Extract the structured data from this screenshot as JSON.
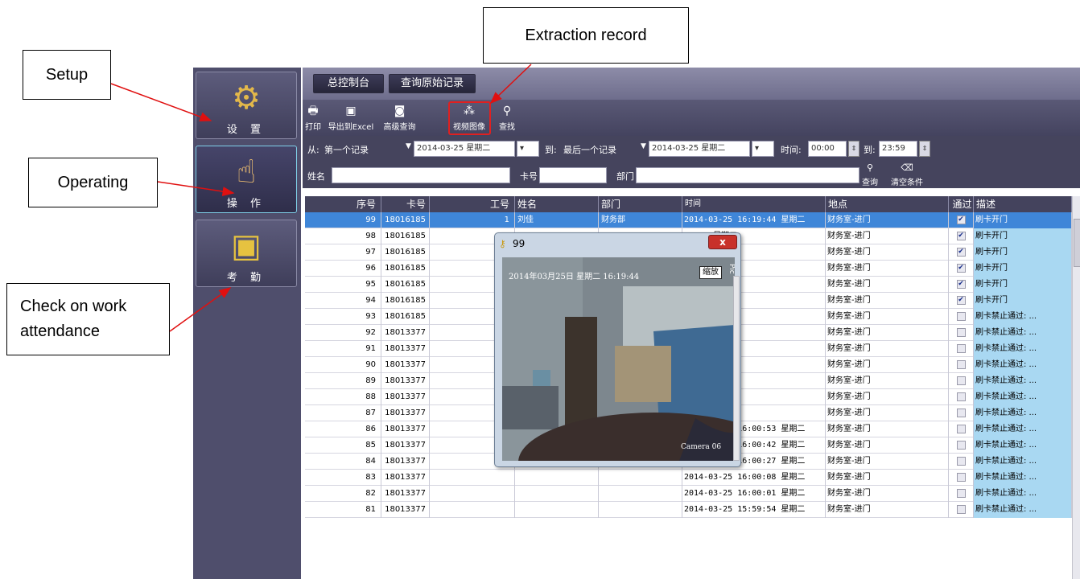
{
  "callouts": {
    "setup": "Setup",
    "extraction": "Extraction record",
    "operating": "Operating",
    "check_line1": "Check on work",
    "check_line2": "attendance"
  },
  "sidebar": {
    "items": [
      {
        "label": "设 置",
        "icon": "gear-icon"
      },
      {
        "label": "操 作",
        "icon": "hand-pointer-icon"
      },
      {
        "label": "考 勤",
        "icon": "id-card-icon"
      }
    ]
  },
  "tabs": [
    "总控制台",
    "查询原始记录"
  ],
  "toolbar": {
    "print": "打印",
    "excel": "导出到Excel",
    "advanced": "高级查询",
    "video": "视频图像",
    "find": "查找"
  },
  "filter": {
    "from_label": "从:",
    "from_value": "第一个记录",
    "from_date": "2014-03-25 星期二",
    "to_label": "到:",
    "to_value": "最后一个记录",
    "to_date": "2014-03-25 星期二",
    "time_label": "时间:",
    "time_from": "00:00",
    "time_to_label": "到:",
    "time_to": "23:59",
    "name_label": "姓名",
    "card_label": "卡号",
    "dept_label": "部门",
    "query_btn": "查询",
    "clear_btn": "清空条件"
  },
  "grid": {
    "headers": [
      "序号",
      "卡号",
      "工号",
      "姓名",
      "部门",
      "时间",
      "地点",
      "通过",
      "描述"
    ],
    "rows": [
      {
        "no": "99",
        "card": "18016185",
        "emp": "1",
        "name": "刘佳",
        "dept": "财务部",
        "time": "2014-03-25 16:19:44 星期二",
        "place": "财务室-进门",
        "pass": true,
        "desc": "刷卡开门"
      },
      {
        "no": "98",
        "card": "18016185",
        "emp": "",
        "name": "",
        "dept": "",
        "time": "19:31 星期二",
        "place": "财务室-进门",
        "pass": true,
        "desc": "刷卡开门"
      },
      {
        "no": "97",
        "card": "18016185",
        "emp": "",
        "name": "",
        "dept": "",
        "time": "18:04 星期二",
        "place": "财务室-进门",
        "pass": true,
        "desc": "刷卡开门"
      },
      {
        "no": "96",
        "card": "18016185",
        "emp": "",
        "name": "",
        "dept": "",
        "time": "17:39 星期二",
        "place": "财务室-进门",
        "pass": true,
        "desc": "刷卡开门"
      },
      {
        "no": "95",
        "card": "18016185",
        "emp": "",
        "name": "",
        "dept": "",
        "time": "17:05 星期二",
        "place": "财务室-进门",
        "pass": true,
        "desc": "刷卡开门"
      },
      {
        "no": "94",
        "card": "18016185",
        "emp": "",
        "name": "",
        "dept": "",
        "time": "08:44 星期二",
        "place": "财务室-进门",
        "pass": true,
        "desc": "刷卡开门"
      },
      {
        "no": "93",
        "card": "18016185",
        "emp": "",
        "name": "",
        "dept": "",
        "time": "06:28 星期二",
        "place": "财务室-进门",
        "pass": false,
        "desc": "刷卡禁止通过: ..."
      },
      {
        "no": "92",
        "card": "18013377",
        "emp": "",
        "name": "",
        "dept": "",
        "time": "02:28 星期二",
        "place": "财务室-进门",
        "pass": false,
        "desc": "刷卡禁止通过: ..."
      },
      {
        "no": "91",
        "card": "18013377",
        "emp": "",
        "name": "",
        "dept": "",
        "time": "02:19 星期二",
        "place": "财务室-进门",
        "pass": false,
        "desc": "刷卡禁止通过: ..."
      },
      {
        "no": "90",
        "card": "18013377",
        "emp": "",
        "name": "",
        "dept": "",
        "time": "02:10 星期二",
        "place": "财务室-进门",
        "pass": false,
        "desc": "刷卡禁止通过: ..."
      },
      {
        "no": "89",
        "card": "18013377",
        "emp": "",
        "name": "",
        "dept": "",
        "time": "01:54 星期二",
        "place": "财务室-进门",
        "pass": false,
        "desc": "刷卡禁止通过: ..."
      },
      {
        "no": "88",
        "card": "18013377",
        "emp": "",
        "name": "",
        "dept": "",
        "time": "01:16 星期二",
        "place": "财务室-进门",
        "pass": false,
        "desc": "刷卡禁止通过: ..."
      },
      {
        "no": "87",
        "card": "18013377",
        "emp": "",
        "name": "",
        "dept": "",
        "time": "01:03 星期二",
        "place": "财务室-进门",
        "pass": false,
        "desc": "刷卡禁止通过: ..."
      },
      {
        "no": "86",
        "card": "18013377",
        "emp": "",
        "name": "",
        "dept": "",
        "time": "2014-03-25 16:00:53 星期二",
        "place": "财务室-进门",
        "pass": false,
        "desc": "刷卡禁止通过: ..."
      },
      {
        "no": "85",
        "card": "18013377",
        "emp": "",
        "name": "",
        "dept": "",
        "time": "2014-03-25 16:00:42 星期二",
        "place": "财务室-进门",
        "pass": false,
        "desc": "刷卡禁止通过: ..."
      },
      {
        "no": "84",
        "card": "18013377",
        "emp": "",
        "name": "",
        "dept": "",
        "time": "2014-03-25 16:00:27 星期二",
        "place": "财务室-进门",
        "pass": false,
        "desc": "刷卡禁止通过: ..."
      },
      {
        "no": "83",
        "card": "18013377",
        "emp": "",
        "name": "",
        "dept": "",
        "time": "2014-03-25 16:00:08 星期二",
        "place": "财务室-进门",
        "pass": false,
        "desc": "刷卡禁止通过: ..."
      },
      {
        "no": "82",
        "card": "18013377",
        "emp": "",
        "name": "",
        "dept": "",
        "time": "2014-03-25 16:00:01 星期二",
        "place": "财务室-进门",
        "pass": false,
        "desc": "刷卡禁止通过: ..."
      },
      {
        "no": "81",
        "card": "18013377",
        "emp": "",
        "name": "",
        "dept": "",
        "time": "2014-03-25 15:59:54 星期二",
        "place": "财务室-进门",
        "pass": false,
        "desc": "刷卡禁止通过: ..."
      }
    ]
  },
  "popup": {
    "title": "99",
    "close": "x",
    "timestamp": "2014年03月25日 星期二 16:19:44",
    "zoom": "缩放",
    "pic": "Pic",
    "camera": "Camera 06"
  },
  "colors": {
    "arrow": "#e01010",
    "selected_row": "#3f86d8",
    "desc_column": "#a9d8f2",
    "sidebar": "#4f4e6c"
  }
}
